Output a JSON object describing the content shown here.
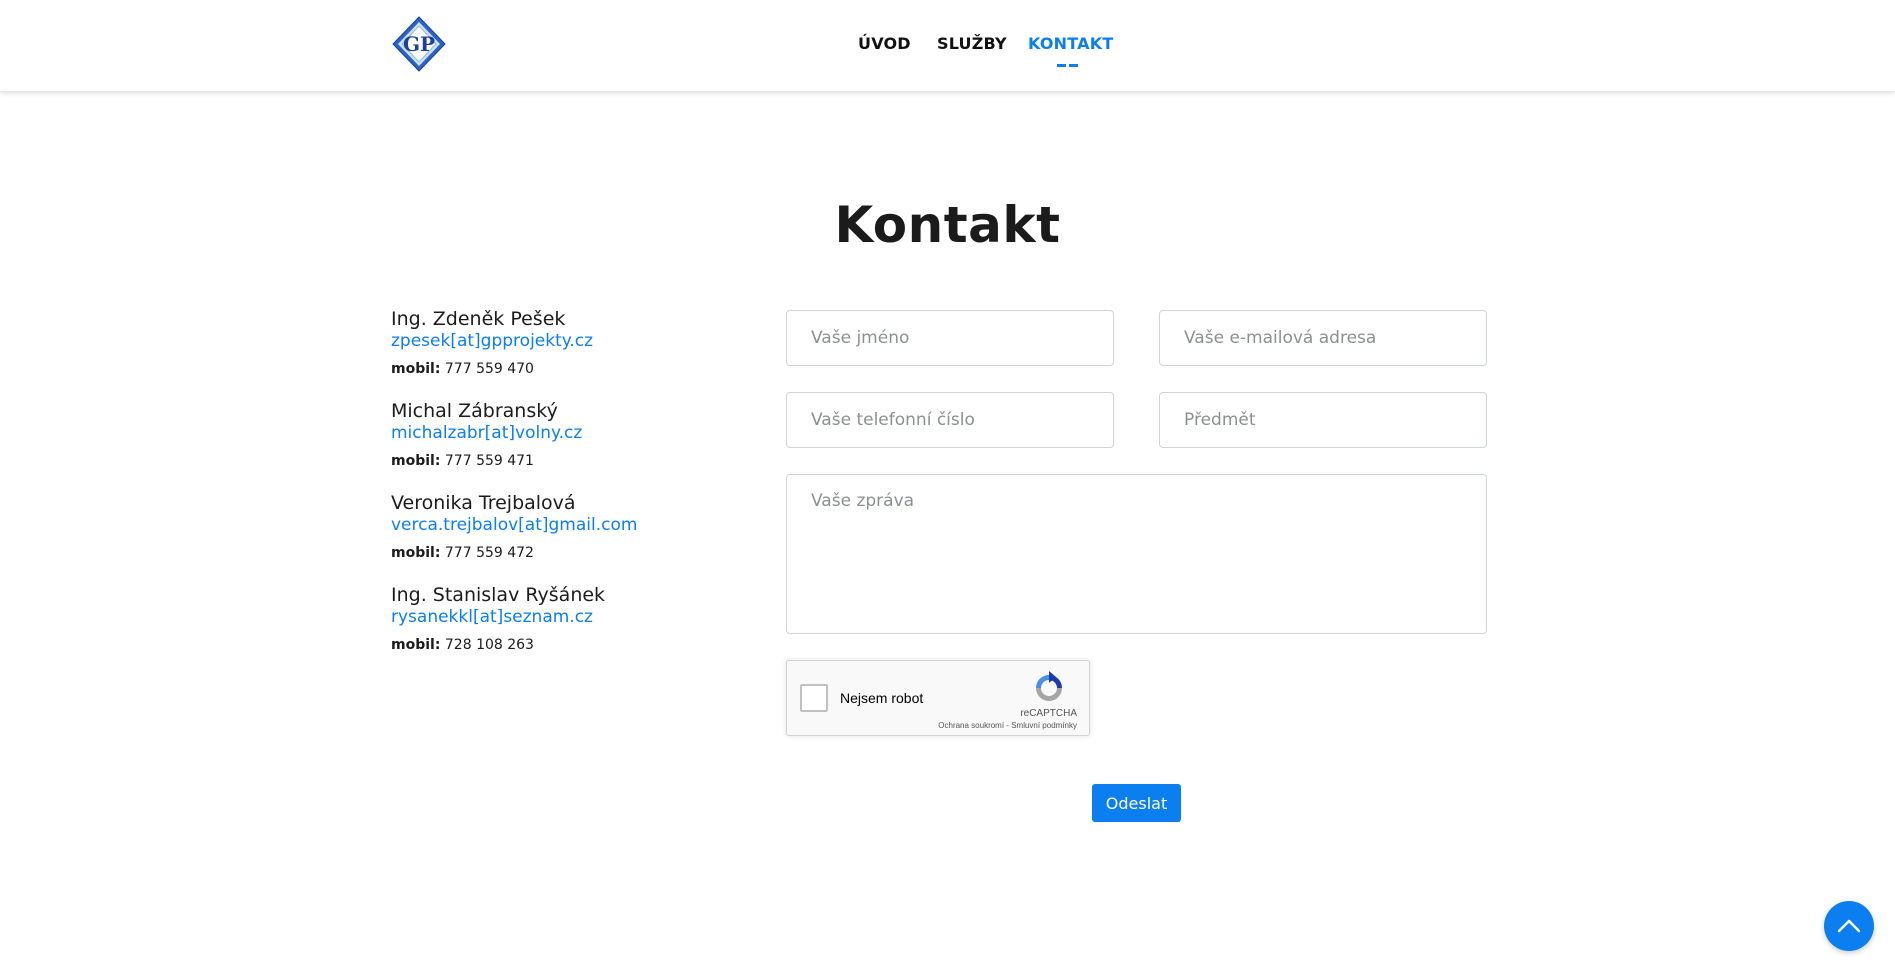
{
  "header": {
    "logo_text": "GP",
    "nav": [
      {
        "label": "ÚVOD",
        "active": false
      },
      {
        "label": "SLUŽBY",
        "active": false
      },
      {
        "label": "KONTAKT",
        "active": true
      }
    ]
  },
  "page": {
    "title": "Kontakt"
  },
  "contacts": [
    {
      "name": "Ing. Zdeněk Pešek",
      "email": "zpesek[at]gpprojekty.cz",
      "mobile_label": "mobil:",
      "mobile": "777 559 470"
    },
    {
      "name": "Michal Zábranský",
      "email": "michalzabr[at]volny.cz",
      "mobile_label": "mobil:",
      "mobile": "777 559 471"
    },
    {
      "name": "Veronika Trejbalová",
      "email": "verca.trejbalov[at]gmail.com",
      "mobile_label": "mobil:",
      "mobile": "777 559 472"
    },
    {
      "name": "Ing. Stanislav Ryšánek",
      "email": "rysanekkl[at]seznam.cz",
      "mobile_label": "mobil:",
      "mobile": "728 108 263"
    }
  ],
  "form": {
    "name_placeholder": "Vaše jméno",
    "email_placeholder": "Vaše e-mailová adresa",
    "phone_placeholder": "Vaše telefonní číslo",
    "subject_placeholder": "Předmět",
    "message_placeholder": "Vaše zpráva",
    "recaptcha": {
      "label": "Nejsem robot",
      "brand": "reCAPTCHA",
      "privacy": "Ochrana soukromí",
      "separator": " - ",
      "terms": "Smluvní podmínky"
    },
    "submit_label": "Odeslat"
  },
  "colors": {
    "accent": "#0b7ef0",
    "text": "#1c1c1c",
    "border": "#cfd4d9"
  }
}
